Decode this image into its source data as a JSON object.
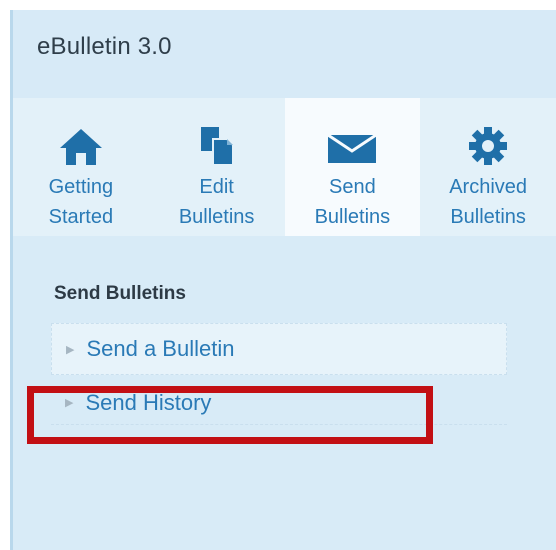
{
  "app": {
    "title": "eBulletin 3.0"
  },
  "nav": {
    "items": [
      {
        "label_line1": "Getting",
        "label_line2": "Started",
        "icon": "home-icon",
        "active": false
      },
      {
        "label_line1": "Edit",
        "label_line2": "Bulletins",
        "icon": "documents-icon",
        "active": false
      },
      {
        "label_line1": "Send",
        "label_line2": "Bulletins",
        "icon": "envelope-icon",
        "active": true
      },
      {
        "label_line1": "Archived",
        "label_line2": "Bulletins",
        "icon": "gear-icon",
        "active": false
      }
    ]
  },
  "section": {
    "title": "Send Bulletins",
    "items": [
      {
        "label": "Send a Bulletin"
      },
      {
        "label": "Send History"
      }
    ]
  },
  "colors": {
    "accent_blue": "#2a7ab6",
    "icon_blue": "#1f6fa8",
    "highlight_red": "#c20f14"
  }
}
